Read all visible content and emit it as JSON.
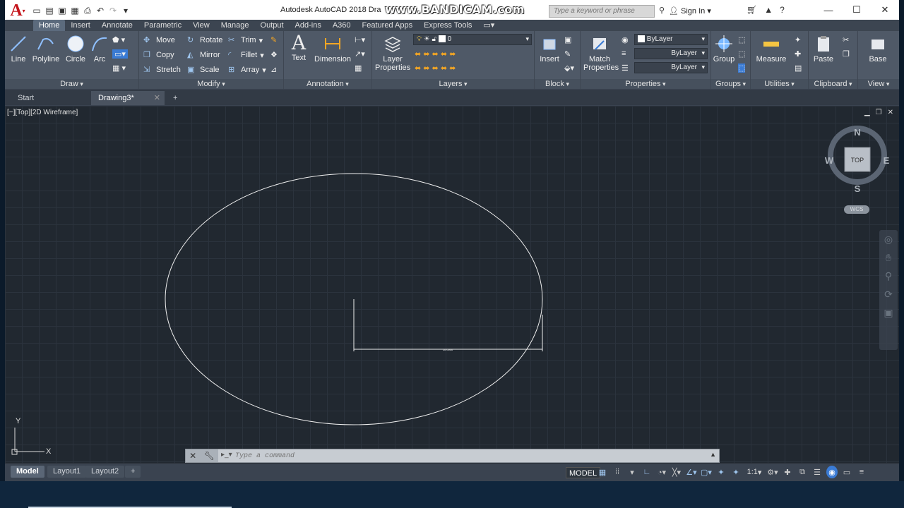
{
  "titlebar": {
    "app_title": "Autodesk AutoCAD 2018    Dra",
    "watermark": "www.BANDICAM.com",
    "search_placeholder": "Type a keyword or phrase",
    "signin": "Sign In"
  },
  "menu_tabs": [
    "Home",
    "Insert",
    "Annotate",
    "Parametric",
    "View",
    "Manage",
    "Output",
    "Add-ins",
    "A360",
    "Featured Apps",
    "Express Tools"
  ],
  "ribbon": {
    "draw": {
      "title": "Draw",
      "line": "Line",
      "polyline": "Polyline",
      "circle": "Circle",
      "arc": "Arc"
    },
    "modify": {
      "title": "Modify",
      "move": "Move",
      "rotate": "Rotate",
      "trim": "Trim",
      "copy": "Copy",
      "mirror": "Mirror",
      "fillet": "Fillet",
      "stretch": "Stretch",
      "scale": "Scale",
      "array": "Array"
    },
    "annotation": {
      "title": "Annotation",
      "text": "Text",
      "dimension": "Dimension"
    },
    "layers": {
      "title": "Layers",
      "layer_properties": "Layer Properties",
      "current_layer": "0"
    },
    "block": {
      "title": "Block",
      "insert": "Insert"
    },
    "properties": {
      "title": "Properties",
      "match": "Match Properties",
      "color": "ByLayer",
      "linetype": "ByLayer",
      "lineweight": "ByLayer"
    },
    "groups": {
      "title": "Groups",
      "group": "Group"
    },
    "utilities": {
      "title": "Utilities",
      "measure": "Measure"
    },
    "clipboard": {
      "title": "Clipboard",
      "paste": "Paste"
    },
    "view": {
      "title": "View",
      "base": "Base"
    }
  },
  "file_tabs": {
    "start": "Start",
    "drawing": "Drawing3*"
  },
  "viewport": {
    "label": "[−][Top][2D Wireframe]",
    "dimension_text": "10.0000"
  },
  "viewcube": {
    "n": "N",
    "s": "S",
    "e": "E",
    "w": "W",
    "face": "TOP",
    "ucs": "WCS"
  },
  "ucs": {
    "x": "X",
    "y": "Y"
  },
  "command": {
    "placeholder": "Type a command"
  },
  "layout_tabs": [
    "Model",
    "Layout1",
    "Layout2"
  ],
  "status": {
    "model": "MODEL",
    "scale": "1:1"
  },
  "colors": {
    "viewport_bg": "#212830",
    "grid": "#2b333d",
    "ribbon": "#4f5967",
    "accent": "#9fc6ef"
  }
}
